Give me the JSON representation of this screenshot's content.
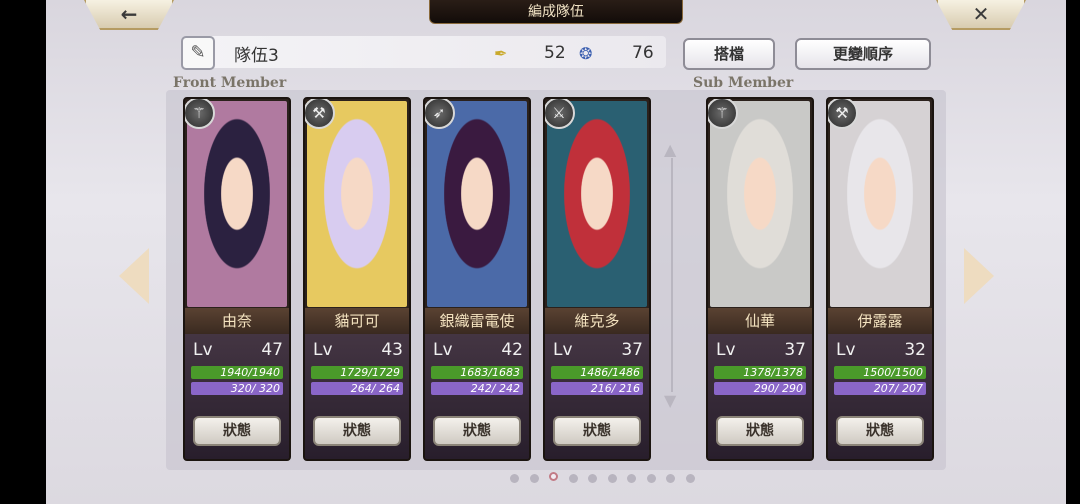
{
  "header": {
    "title": "編成隊伍",
    "back_label": "←",
    "close_label": "✕"
  },
  "team": {
    "edit_icon": "pen-icon",
    "name": "隊伍3",
    "feather_value": "52",
    "swirl_value": "76"
  },
  "buttons": {
    "partner": "搭檔",
    "reorder": "更變順序",
    "status": "狀態"
  },
  "sections": {
    "front": "Front Member",
    "sub": "Sub Member"
  },
  "members": [
    {
      "name": "由奈",
      "weapon_icon": "staff-icon",
      "lv_label": "Lv",
      "lv": "47",
      "hp": "1940/1940",
      "mp": "320/ 320",
      "bg": "#b07aa0",
      "hair": "#2b2140"
    },
    {
      "name": "貓可可",
      "weapon_icon": "axe-icon",
      "lv_label": "Lv",
      "lv": "43",
      "hp": "1729/1729",
      "mp": "264/ 264",
      "bg": "#e7c960",
      "hair": "#d8ccf0"
    },
    {
      "name": "銀織雷電使",
      "weapon_icon": "bow-icon",
      "lv_label": "Lv",
      "lv": "42",
      "hp": "1683/1683",
      "mp": "242/ 242",
      "bg": "#4b6aa8",
      "hair": "#3a1a40"
    },
    {
      "name": "維克多",
      "weapon_icon": "sword-icon",
      "lv_label": "Lv",
      "lv": "37",
      "hp": "1486/1486",
      "mp": "216/ 216",
      "bg": "#2a6072",
      "hair": "#c0303a"
    },
    {
      "name": "仙華",
      "weapon_icon": "staff-icon",
      "lv_label": "Lv",
      "lv": "37",
      "hp": "1378/1378",
      "mp": "290/ 290",
      "bg": "#c9c9c7",
      "hair": "#e0ddd8"
    },
    {
      "name": "伊露露",
      "weapon_icon": "axe-icon",
      "lv_label": "Lv",
      "lv": "32",
      "hp": "1500/1500",
      "mp": "207/ 207",
      "bg": "#d6d2d4",
      "hair": "#e8e6ea"
    }
  ],
  "pagination": {
    "total": 10,
    "active_index": 2
  },
  "colors": {
    "hp": "#4a9a2a",
    "mp": "#8a66c8",
    "accent": "#b59b62"
  }
}
